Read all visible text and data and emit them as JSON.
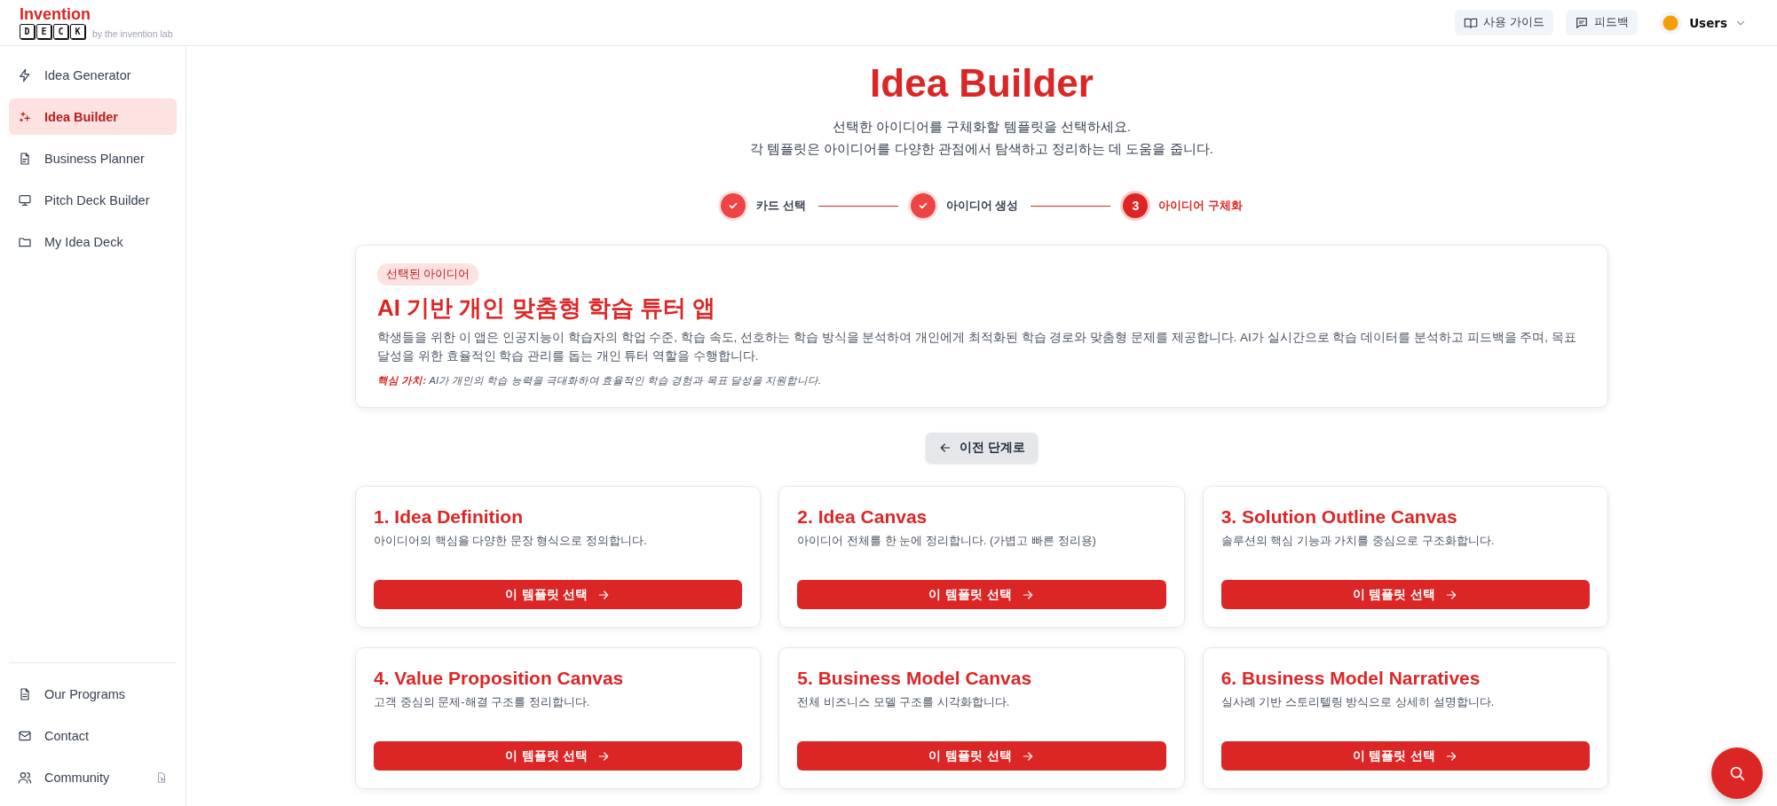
{
  "logo": {
    "wordmark": "Invention",
    "letters": [
      "D",
      "E",
      "C",
      "K"
    ],
    "tagline": "by the invention lab"
  },
  "header": {
    "guide_button": "사용 가이드",
    "feedback_button": "피드백",
    "user_menu": "Users"
  },
  "sidebar": {
    "items": [
      {
        "label": "Idea Generator",
        "selected": false,
        "external": false
      },
      {
        "label": "Idea Builder",
        "selected": true,
        "external": false
      },
      {
        "label": "Business Planner",
        "selected": false,
        "external": false
      },
      {
        "label": "Pitch Deck Builder",
        "selected": false,
        "external": false
      },
      {
        "label": "My Idea Deck",
        "selected": false,
        "external": false
      }
    ],
    "footer_items": [
      {
        "label": "Our Programs",
        "selected": false,
        "external": false
      },
      {
        "label": "Contact",
        "selected": false,
        "external": false
      },
      {
        "label": "Community",
        "selected": false,
        "external": true
      }
    ]
  },
  "page": {
    "title": "Idea Builder",
    "subtitle_lines": [
      "선택한 아이디어를 구체화할 템플릿을 선택하세요.",
      "각 템플릿은 아이디어를 다양한 관점에서 탐색하고 정리하는 데 도움을 줍니다."
    ]
  },
  "steps": [
    {
      "label": "카드 선택",
      "completed": true
    },
    {
      "label": "아이디어 생성",
      "completed": true
    },
    {
      "number": "3",
      "label": "아이디어 구체화",
      "completed": false
    }
  ],
  "selected_idea": {
    "badge": "선택된 아이디어",
    "title": "AI 기반 개인 맞춤형 학습 튜터 앱",
    "description": "학생들을 위한 이 앱은 인공지능이 학습자의 학업 수준, 학습 속도, 선호하는 학습 방식을 분석하여 개인에게 최적화된 학습 경로와 맞춤형 문제를 제공합니다. AI가 실시간으로 학습 데이터를 분석하고 피드백을 주며, 목표 달성을 위한 효율적인 학습 관리를 돕는 개인 튜터 역할을 수행합니다.",
    "core_value": "**핵심 가치:** AI가 개인의 학습 능력을 극대화하여 효율적인 학습 경험과 목표 달성을 지원합니다."
  },
  "back_button": "이전 단계로",
  "templates": [
    {
      "title": "1. Idea Definition",
      "description": "아이디어의 핵심을 다양한 문장 형식으로 정의합니다.",
      "button": "이 템플릿 선택"
    },
    {
      "title": "2. Idea Canvas",
      "description": "아이디어 전체를 한 눈에 정리합니다. (가볍고 빠른 정리용)",
      "button": "이 템플릿 선택"
    },
    {
      "title": "3. Solution Outline Canvas",
      "description": "솔루션의 핵심 기능과 가치를 중심으로 구조화합니다.",
      "button": "이 템플릿 선택"
    },
    {
      "title": "4. Value Proposition Canvas",
      "description": "고객 중심의 문제-해결 구조를 정리합니다.",
      "button": "이 템플릿 선택"
    },
    {
      "title": "5. Business Model Canvas",
      "description": "전체 비즈니스 모델 구조를 시각화합니다.",
      "button": "이 템플릿 선택"
    },
    {
      "title": "6. Business Model Narratives",
      "description": "실사례 기반 스토리텔링 방식으로 상세히 설명합니다.",
      "button": "이 템플릿 선택"
    }
  ]
}
